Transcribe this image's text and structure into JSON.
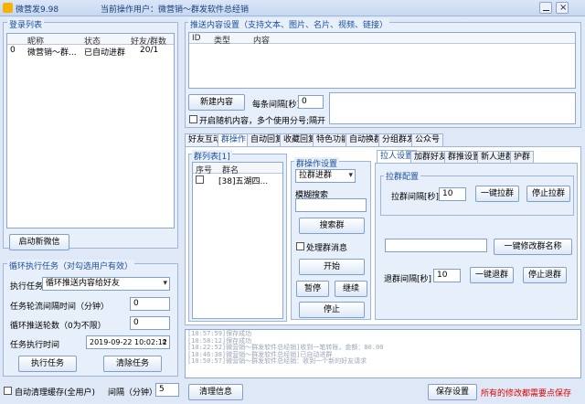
{
  "window": {
    "title": "微营发9.98",
    "user_prefix": "当前操作用户：",
    "user": "微营销～群发软件总经销"
  },
  "login": {
    "title": "登录列表",
    "columns": [
      "",
      "昵称",
      "状态",
      "好友/群数"
    ],
    "rows": [
      [
        "0",
        "微营销～群...",
        "已自动进群",
        "20/1"
      ]
    ],
    "start_wechat": "启动新微信"
  },
  "loop": {
    "title": "循环执行任务（对勾选用户有效）",
    "task_label": "执行任务",
    "task_value": "循环推送内容给好友",
    "interval_label": "任务轮流间隔时间（分钟）",
    "interval_value": "0",
    "rounds_label": "循环推送轮数（0为不限）",
    "rounds_value": "0",
    "time_label": "任务执行时间",
    "time_value": "2019-09-22 10:02:12",
    "run": "执行任务",
    "clear": "清除任务"
  },
  "bottom": {
    "auto_clear": "自动清理缓存(全用户)",
    "interval_label": "间隔（分钟）",
    "interval_value": "5",
    "clear_info": "清理信息",
    "save": "保存设置",
    "note": "所有的修改都需要点保存"
  },
  "content": {
    "title": "推送内容设置（支持文本、图片、名片、视频、链接）",
    "columns": [
      "ID",
      "类型",
      "内容"
    ],
    "new_button": "新建内容",
    "interval_label": "每条间隔[秒]",
    "interval_value": "0",
    "random_label": "开启随机内容，多个使用分号;隔开"
  },
  "tabs": [
    "好友互动",
    "群操作",
    "自动回复",
    "收藏回复",
    "特色功能",
    "自动换群",
    "分组群发",
    "公众号"
  ],
  "group": {
    "list_title": "群列表[1]",
    "col_no": "序号",
    "col_name": "群名",
    "row_name": "[38]五湖四...",
    "op_title": "群操作设置",
    "op_value": "拉群进群",
    "fuzzy": "模糊搜索",
    "search": "搜索群",
    "handle_msg": "处理群消息",
    "start": "开始",
    "pause": "暂停",
    "resume": "继续",
    "stop": "停止"
  },
  "subtabs": [
    "拉人设置",
    "加群好友",
    "群推设置",
    "新人进群",
    "护群"
  ],
  "pull": {
    "config": "拉群配置",
    "interval_label": "拉群间隔[秒]",
    "interval_value": "10",
    "one_key": "一键拉群",
    "stop": "停止拉群",
    "rename": "一键修改群名称",
    "exit_label": "退群间隔[秒]",
    "exit_value": "10",
    "one_exit": "一键退群",
    "stop_exit": "停止退群"
  },
  "logs": [
    "[10:57:59]保存成功",
    "[10:58:12]保存成功",
    "[10:22:52]微营销～群发软件总经销]收到一笔转账，金额：80.00",
    "[10:46:38]微营销～群发软件总经销]已自动进群",
    "[10:50:57]微营销～群发软件总经销：收到一个新的好友请求"
  ]
}
